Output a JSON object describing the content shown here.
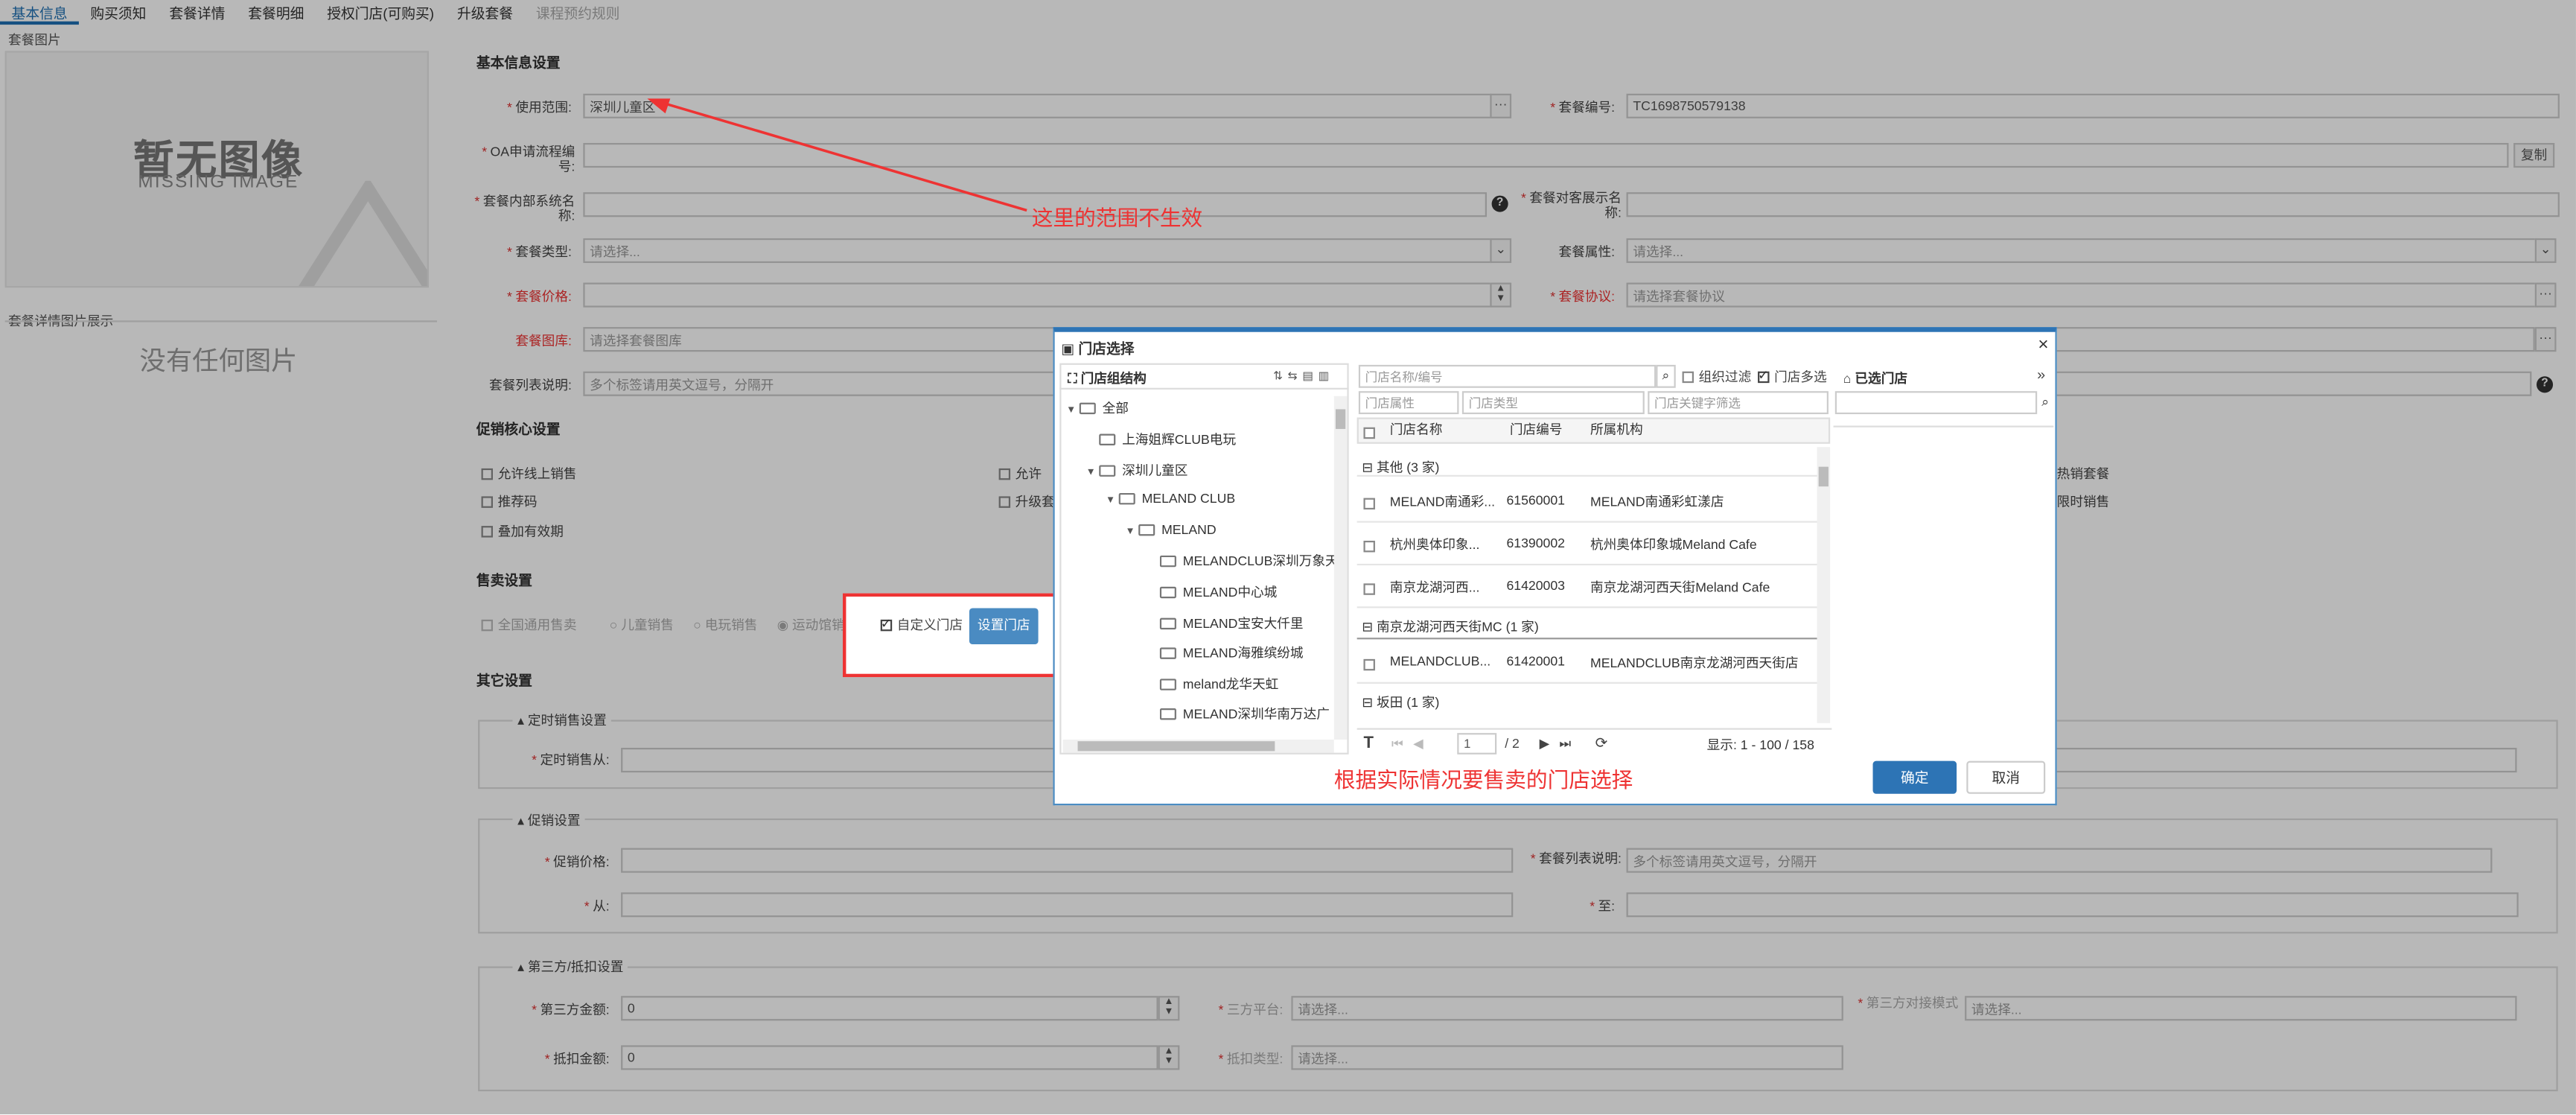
{
  "tabs": [
    {
      "label": "基本信息",
      "active": true
    },
    {
      "label": "购买须知"
    },
    {
      "label": "套餐详情"
    },
    {
      "label": "套餐明细"
    },
    {
      "label": "授权门店(可购买)"
    },
    {
      "label": "升级套餐"
    },
    {
      "label": "课程预约规则",
      "disabled": true
    }
  ],
  "left": {
    "image_label": "套餐图片",
    "no_image_cn": "暂无图像",
    "no_image_en": "MISSING IMAGE",
    "detail_label": "套餐详情图片展示",
    "no_pictures": "没有任何图片"
  },
  "basic": {
    "title": "基本信息设置",
    "scope_label": "使用范围:",
    "scope_value": "深圳儿童区",
    "code_label": "套餐编号:",
    "code_value": "TC1698750579138",
    "oa_label": "OA申请流程编号:",
    "copy_btn": "复制",
    "internal_label": "套餐内部系统名称:",
    "display_label": "套餐对客展示名称:",
    "type_label": "套餐类型:",
    "type_ph": "请选择...",
    "attr_label": "套餐属性:",
    "attr_ph": "请选择...",
    "price_label": "套餐价格:",
    "agreement_label": "套餐协议:",
    "agreement_ph": "请选择套餐协议",
    "gallery_label": "套餐图库:",
    "gallery_ph": "请选择套餐图库",
    "desc_label": "套餐列表说明:",
    "desc_ph": "多个标签请用英文逗号，分隔开"
  },
  "promo": {
    "title": "促销核心设置",
    "items": [
      "允许线上销售",
      "允许",
      "推荐码",
      "升级套",
      "叠加有效期",
      "热销套餐",
      "限时销售"
    ]
  },
  "sale": {
    "title": "售卖设置",
    "opts": [
      "全国通用售卖",
      "儿童销售",
      "电玩销售",
      "运动馆销售"
    ],
    "custom_label": "自定义门店",
    "set_store_btn": "设置门店"
  },
  "other": {
    "title": "其它设置",
    "timed_title": "定时销售设置",
    "timed_from": "定时销售从:",
    "promo_title": "促销设置",
    "promo_price": "促销价格:",
    "promo_desc": "套餐列表说明:",
    "promo_desc_ph": "多个标签请用英文逗号，分隔开",
    "from": "从:",
    "to": "至:",
    "third_title": "第三方/抵扣设置",
    "third_amount": "第三方金额:",
    "third_amount_val": "0",
    "third_platform": "三方平台:",
    "third_platform_ph": "请选择...",
    "third_product": "第三方对接模式",
    "third_product_ph": "请选择...",
    "deduct_amount": "抵扣金额:",
    "deduct_amount_val": "0",
    "deduct_type": "抵扣类型:",
    "deduct_type_ph": "请选择..."
  },
  "dialog": {
    "title": "门店选择",
    "org_title": "门店组结构",
    "tree": [
      "全部",
      "上海姐辉CLUB电玩",
      "深圳儿童区",
      "MELAND CLUB",
      "MELAND",
      "MELANDCLUB深圳万象天",
      "MELAND中心城",
      "MELAND宝安大仟里",
      "MELAND海雅缤纷城",
      "meland龙华天虹",
      "MELAND深圳华南万达广"
    ],
    "search_ph": "门店名称/编号",
    "org_filter": "组织过滤",
    "multi_select": "门店多选",
    "attr_ph": "门店属性",
    "type_ph": "门店类型",
    "keyword_ph": "门店关键字筛选",
    "columns": [
      "门店名称",
      "门店编号",
      "所属机构"
    ],
    "groups": [
      {
        "label": "其他 (3 家)",
        "rows": [
          [
            "MELAND南通彩...",
            "61560001",
            "MELAND南通彩虹漾店"
          ],
          [
            "杭州奥体印象...",
            "61390002",
            "杭州奥体印象城Meland Cafe"
          ],
          [
            "南京龙湖河西...",
            "61420003",
            "南京龙湖河西天街Meland Cafe"
          ]
        ]
      },
      {
        "label": "南京龙湖河西天街MC (1 家)",
        "rows": [
          [
            "MELANDCLUB...",
            "61420001",
            "MELANDCLUB南京龙湖河西天街店"
          ]
        ]
      },
      {
        "label": "坂田 (1 家)",
        "rows": []
      }
    ],
    "page_value": "1",
    "page_total": "/ 2",
    "display_info": "显示: 1 - 100 / 158",
    "selected_title": "已选门店",
    "ok": "确定",
    "cancel": "取消"
  },
  "annotations": {
    "scope_note": "这里的范围不生效",
    "store_note": "根据实际情况要售卖的门店选择"
  },
  "colors": {
    "accent": "#2d74b5",
    "annotation": "#e33333",
    "required": "#dd3333"
  }
}
